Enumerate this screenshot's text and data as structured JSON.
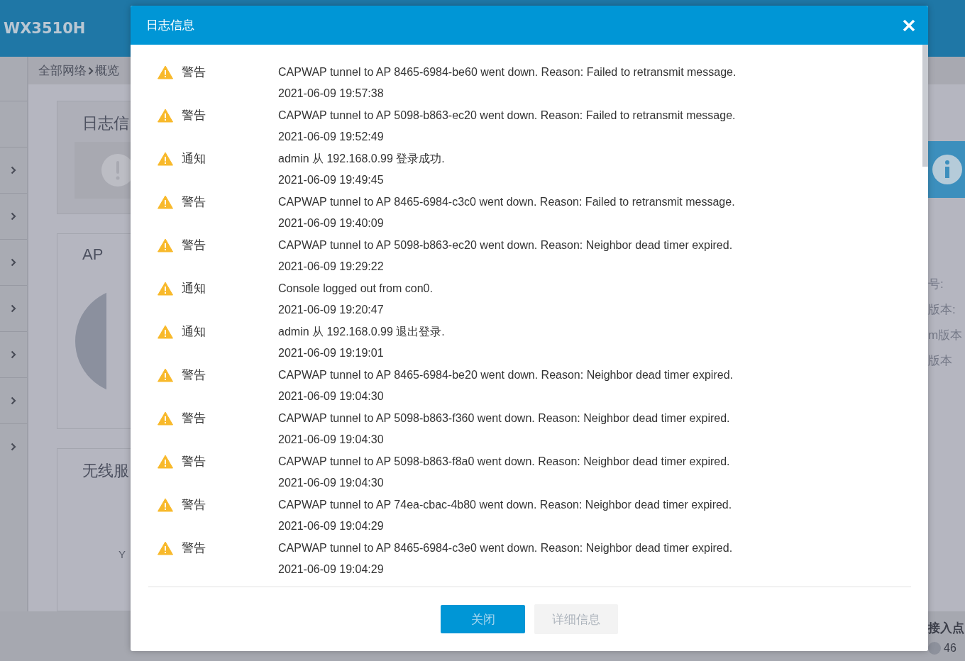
{
  "app": {
    "title": "WX3510H"
  },
  "breadcrumb": {
    "parent": "全部网络",
    "current": "概览"
  },
  "cards": [
    {
      "title": "日志信"
    },
    {
      "title": "AP"
    },
    {
      "title": "无线服",
      "label": "Y"
    }
  ],
  "right_panel": {
    "labels": [
      "号:",
      "版本:",
      "m版本",
      "版本"
    ],
    "footer_title": "接入点",
    "count": "46"
  },
  "dialog": {
    "title": "日志信息",
    "entries": [
      {
        "level": "警告",
        "message": "CAPWAP tunnel to AP 8465-6984-be60 went down. Reason: Failed to retransmit message.",
        "time": "2021-06-09 19:57:38"
      },
      {
        "level": "警告",
        "message": "CAPWAP tunnel to AP 5098-b863-ec20 went down. Reason: Failed to retransmit message.",
        "time": "2021-06-09 19:52:49"
      },
      {
        "level": "通知",
        "message": "admin 从 192.168.0.99 登录成功.",
        "time": "2021-06-09 19:49:45"
      },
      {
        "level": "警告",
        "message": "CAPWAP tunnel to AP 8465-6984-c3c0 went down. Reason: Failed to retransmit message.",
        "time": "2021-06-09 19:40:09"
      },
      {
        "level": "警告",
        "message": "CAPWAP tunnel to AP 5098-b863-ec20 went down. Reason: Neighbor dead timer expired.",
        "time": "2021-06-09 19:29:22"
      },
      {
        "level": "通知",
        "message": "Console logged out from con0.",
        "time": "2021-06-09 19:20:47"
      },
      {
        "level": "通知",
        "message": "admin 从 192.168.0.99 退出登录.",
        "time": "2021-06-09 19:19:01"
      },
      {
        "level": "警告",
        "message": "CAPWAP tunnel to AP 8465-6984-be20 went down. Reason: Neighbor dead timer expired.",
        "time": "2021-06-09 19:04:30"
      },
      {
        "level": "警告",
        "message": "CAPWAP tunnel to AP 5098-b863-f360 went down. Reason: Neighbor dead timer expired.",
        "time": "2021-06-09 19:04:30"
      },
      {
        "level": "警告",
        "message": "CAPWAP tunnel to AP 5098-b863-f8a0 went down. Reason: Neighbor dead timer expired.",
        "time": "2021-06-09 19:04:30"
      },
      {
        "level": "警告",
        "message": "CAPWAP tunnel to AP 74ea-cbac-4b80 went down. Reason: Neighbor dead timer expired.",
        "time": "2021-06-09 19:04:29"
      },
      {
        "level": "警告",
        "message": "CAPWAP tunnel to AP 8465-6984-c3e0 went down. Reason: Neighbor dead timer expired.",
        "time": "2021-06-09 19:04:29"
      }
    ],
    "buttons": [
      {
        "label": "关闭",
        "kind": "primary"
      },
      {
        "label": "详细信息",
        "kind": "secondary"
      }
    ]
  }
}
